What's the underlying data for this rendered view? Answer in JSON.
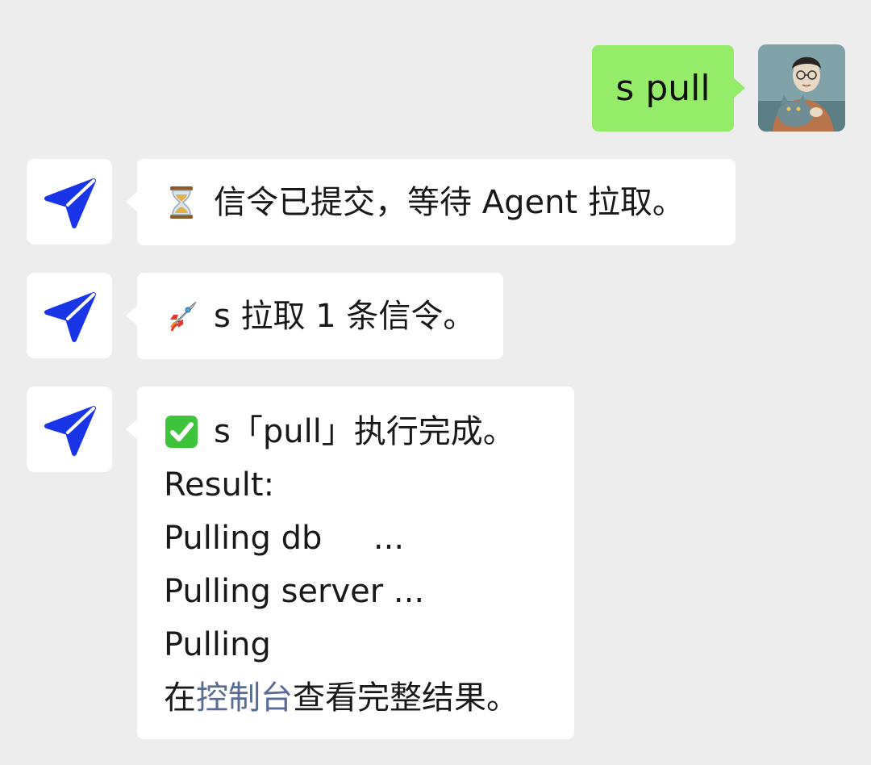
{
  "conversation": {
    "outgoing": {
      "text": "s pull",
      "avatar_icon": "user-portrait-with-cat-avatar"
    },
    "incoming": [
      {
        "icon": "hourglass-icon",
        "text": "信令已提交，等待 Agent 拉取。"
      },
      {
        "icon": "rocket-icon",
        "text": "s 拉取 1 条信令。"
      },
      {
        "icon": "check-mark-button-icon",
        "title": "s「pull」执行完成。",
        "lines": [
          "Result:",
          "Pulling db     ...",
          "Pulling server ...",
          "Pulling"
        ],
        "footer_prefix": "在",
        "footer_link": "控制台",
        "footer_suffix": "查看完整结果。"
      }
    ],
    "bot_avatar_icon": "paper-plane-icon"
  },
  "colors": {
    "background": "#ededed",
    "outgoing_bubble": "#95ec69",
    "incoming_bubble": "#ffffff",
    "bot_icon": "#1a35e8",
    "link": "#576b95"
  }
}
